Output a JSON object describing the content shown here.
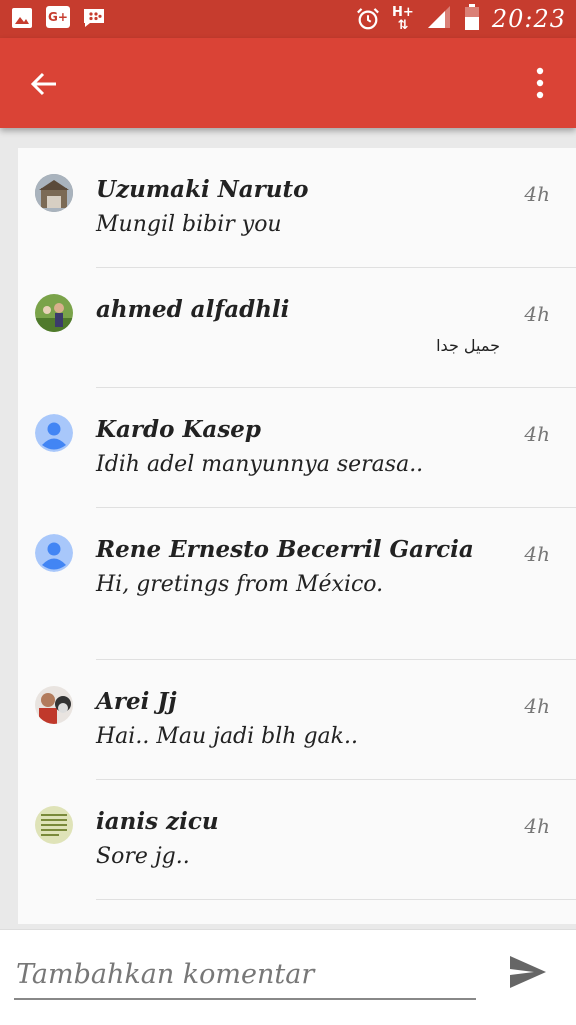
{
  "statusbar": {
    "network_type": "H+",
    "time": "20:23",
    "icons": [
      "gallery-icon",
      "google-plus-icon",
      "bbm-icon",
      "alarm-icon",
      "network-type-icon",
      "signal-icon",
      "battery-icon"
    ],
    "gplus_label": "G+"
  },
  "appbar": {
    "color": "#da4336",
    "icons": [
      "back-arrow-icon",
      "more-vert-icon"
    ]
  },
  "comments": [
    {
      "name": "Uzumaki Naruto",
      "time": "4h",
      "message": "Mungil bibir you",
      "avatar": "building-photo"
    },
    {
      "name": "ahmed alfadhli",
      "time": "4h",
      "message": "جميل جدا",
      "avatar": "outdoor-photo"
    },
    {
      "name": "Kardo Kasep",
      "time": "4h",
      "message": "Idih adel manyunnya serasa..",
      "avatar": "default-person"
    },
    {
      "name": "Rene Ernesto Becerril Garcia",
      "time": "4h",
      "message": "Hi, gretings from México.",
      "avatar": "default-person"
    },
    {
      "name": "Arei Jj",
      "time": "4h",
      "message": "Hai..  Mau jadi blh gak..",
      "avatar": "selfie-photo"
    },
    {
      "name": "ianis zicu",
      "time": "4h",
      "message": "Sore jg..",
      "avatar": "text-image"
    }
  ],
  "composer": {
    "placeholder": "Tambahkan komentar",
    "value": ""
  }
}
